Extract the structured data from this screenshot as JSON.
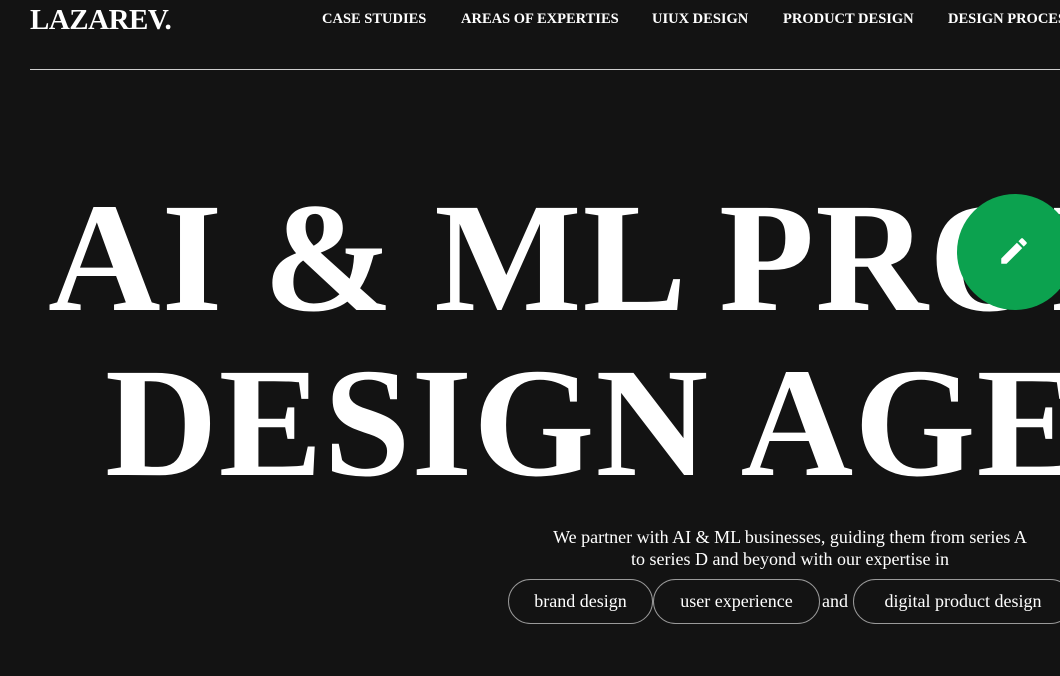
{
  "header": {
    "logo": "LAZAREV.",
    "nav": [
      {
        "label": "CASE STUDIES"
      },
      {
        "label": "AREAS OF EXPERTIES"
      },
      {
        "label": "UIUX DESIGN"
      },
      {
        "label": "PRODUCT DESIGN"
      },
      {
        "label": "DESIGN PROCESS"
      }
    ]
  },
  "hero": {
    "line1": "AI & ML PRODUCT",
    "line2": "DESIGN AGENCY"
  },
  "intro": {
    "tagline_line1": "We partner with AI & ML businesses, guiding them from series A",
    "tagline_line2": "to series D and beyond with our expertise in",
    "services": [
      "brand design",
      "user experience",
      "digital product design"
    ],
    "conjunction": "and"
  },
  "fab": {
    "icon": "pencil-icon",
    "color": "#0ca24f"
  },
  "colors": {
    "background": "#131313",
    "text": "#ffffff",
    "accent": "#0ca24f"
  }
}
